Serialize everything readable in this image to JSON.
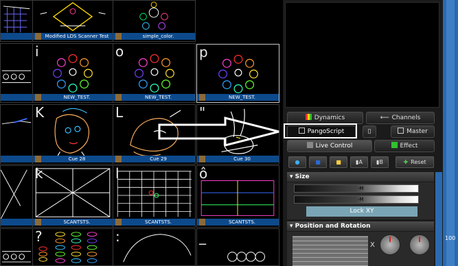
{
  "grid": {
    "cells": [
      {
        "label": "",
        "letter": "",
        "selected": false
      },
      {
        "label": "Modified LDS Scanner Test",
        "letter": "",
        "selected": false
      },
      {
        "label": "simple_color.",
        "letter": "",
        "selected": false
      },
      {
        "label": "",
        "letter": "",
        "selected": false
      },
      {
        "label": "NEW_TEST.",
        "letter": "i",
        "selected": false
      },
      {
        "label": "NEW_TEST.",
        "letter": "o",
        "selected": false
      },
      {
        "label": "NEW_TEST.",
        "letter": "p",
        "selected": true
      },
      {
        "label": "",
        "letter": "",
        "selected": false
      },
      {
        "label": "Cue 28",
        "letter": "K",
        "selected": false
      },
      {
        "label": "Cue 29",
        "letter": "L",
        "selected": false
      },
      {
        "label": "Cue 30",
        "letter": "\"",
        "selected": false
      },
      {
        "label": "",
        "letter": "",
        "selected": false
      },
      {
        "label": "SCANTSTS.",
        "letter": "k",
        "selected": false
      },
      {
        "label": "SCANTSTS.",
        "letter": "l",
        "selected": false
      },
      {
        "label": "SCANTSTS.",
        "letter": "ô",
        "selected": false
      },
      {
        "label": "",
        "letter": "",
        "selected": false
      },
      {
        "label": "",
        "letter": "?",
        "selected": false
      },
      {
        "label": "",
        "letter": ":",
        "selected": false
      },
      {
        "label": "",
        "letter": "_",
        "selected": false
      }
    ]
  },
  "tabs": {
    "dynamics": "Dynamics",
    "channels": "Channels",
    "pangoscript": "PangoScript",
    "master": "Master",
    "live_control": "Live Control",
    "effect": "Effect"
  },
  "toolbar": {
    "a_label": "A",
    "b_label": "B",
    "reset_label": "Reset"
  },
  "size_panel": {
    "title": "Size",
    "slider1_value": "-M",
    "slider2_value": "-M",
    "lock_label": "Lock XY"
  },
  "position_panel": {
    "title": "Position and Rotation",
    "x_label": "X"
  },
  "far_right": {
    "label": "100"
  },
  "colors": {
    "label_bar": "#0d4a8c",
    "accent_blue": "#2a6ab0",
    "lock_button": "#7aa5b5"
  }
}
